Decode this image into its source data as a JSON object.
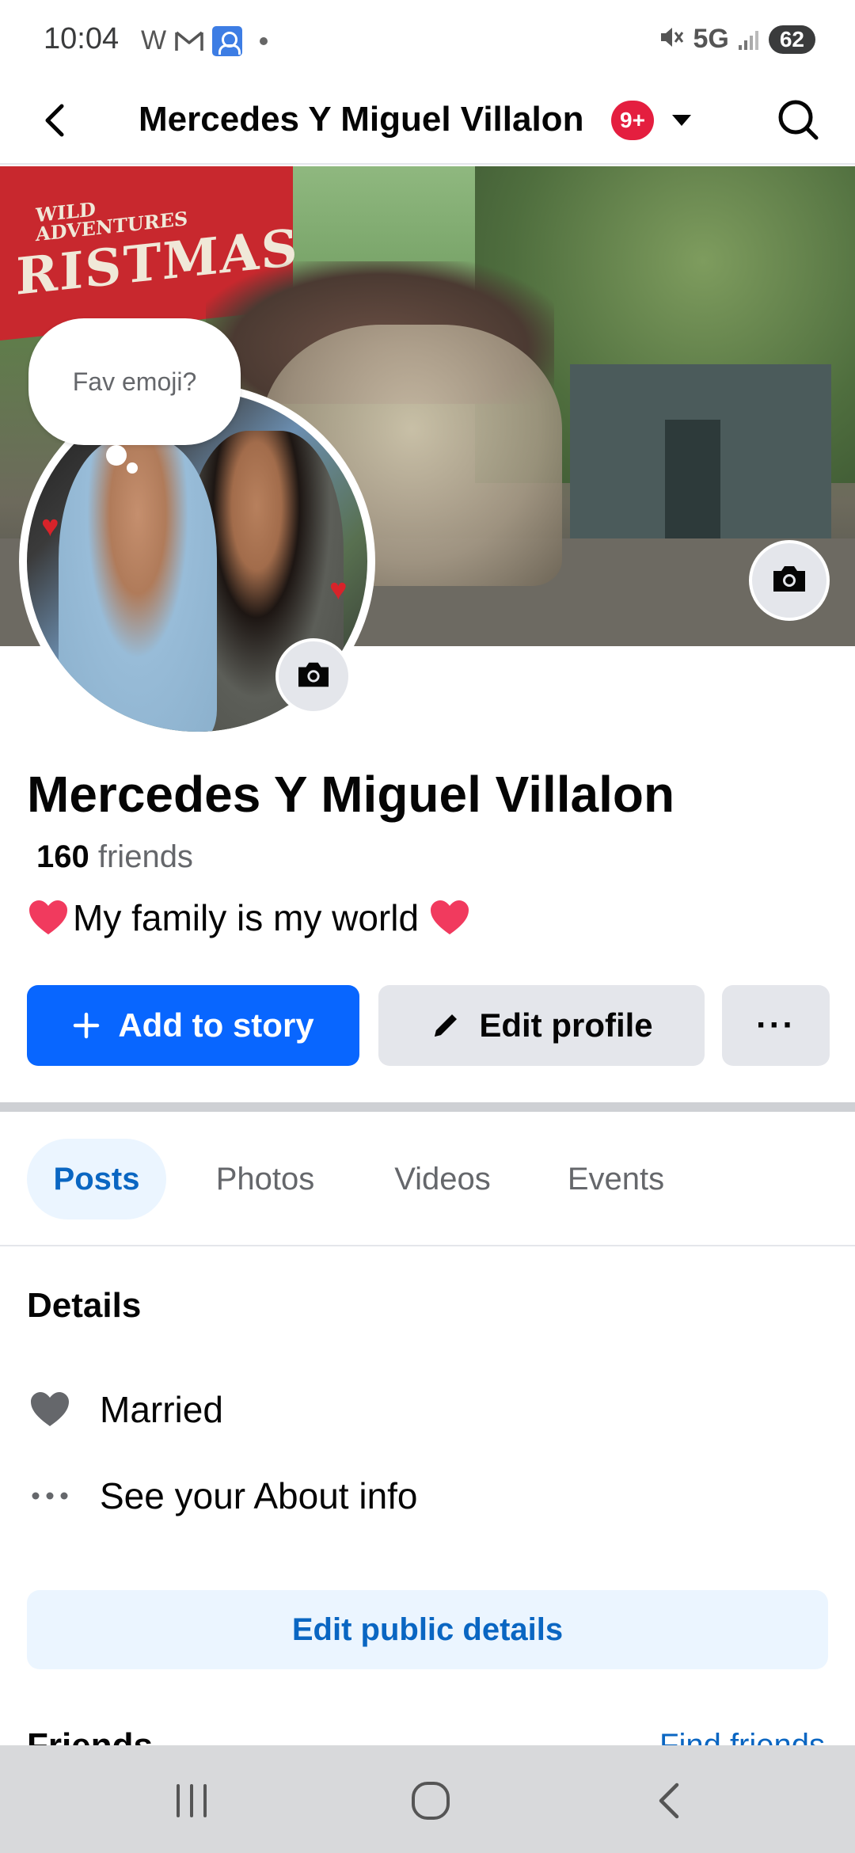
{
  "status_bar": {
    "time": "10:04",
    "left_letter": "W",
    "network": "5G",
    "battery": "62",
    "icons": [
      "gmail-icon",
      "person-icon",
      "mute-icon",
      "signal-icon"
    ]
  },
  "header": {
    "title": "Mercedes Y Miguel Villalon",
    "badge": "9+",
    "icons": [
      "back-icon",
      "caret-down-icon",
      "search-icon"
    ]
  },
  "cover": {
    "sign_small": "WILD\nADVENTURES",
    "sign_large": "RISTMAS"
  },
  "bubble": {
    "text": "Fav emoji?"
  },
  "profile": {
    "name": "Mercedes Y Miguel Villalon",
    "friends_count": "160",
    "friends_label": "friends",
    "bio": "My family is my world"
  },
  "actions": {
    "add_story": "Add to story",
    "edit_profile": "Edit profile",
    "more": "···"
  },
  "tabs": [
    {
      "label": "Posts",
      "active": true
    },
    {
      "label": "Photos",
      "active": false
    },
    {
      "label": "Videos",
      "active": false
    },
    {
      "label": "Events",
      "active": false
    }
  ],
  "details": {
    "title": "Details",
    "items": [
      {
        "icon": "heart-icon",
        "label": "Married"
      },
      {
        "icon": "more-dots-icon",
        "label": "See your About info"
      }
    ],
    "edit_button": "Edit public details"
  },
  "friends_section": {
    "title": "Friends",
    "link": "Find friends"
  },
  "colors": {
    "primary": "#0866ff",
    "link": "#0a66c2",
    "badge": "#e41e3f",
    "gray_button": "#e4e6eb",
    "tab_active_bg": "#ebf5ff"
  }
}
